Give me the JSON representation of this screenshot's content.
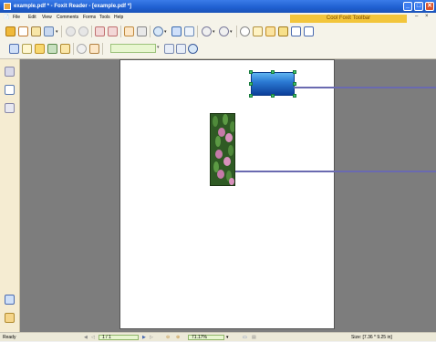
{
  "window": {
    "title": "example.pdf * - Foxit Reader - [example.pdf *]",
    "buttons": {
      "minimize": "_",
      "maximize": "□",
      "close": "✕"
    }
  },
  "menu": {
    "items": [
      "File",
      "Edit",
      "View",
      "Comments",
      "Forms",
      "Tools",
      "Help"
    ],
    "cool_toolbar": "Cool Foxit Toolbar",
    "mdi_buttons": [
      "–",
      "×"
    ]
  },
  "status": {
    "ready": "Ready",
    "page": "1 / 1",
    "zoom": "71.17%",
    "size": "Size: [7.36 * 9.25 in]"
  },
  "icons": [
    "open-folder-icon",
    "save-icon",
    "print-icon",
    "scan-icon",
    "back-icon",
    "forward-icon",
    "hand-tool-icon",
    "select-text-icon",
    "zoom-icon",
    "fit-page-icon",
    "zoom-out-icon",
    "zoom-in-icon",
    "note-icon",
    "typewriter-icon",
    "pencil-icon",
    "text-icon",
    "image-icon",
    "link-icon",
    "highlight-icon",
    "attachment-icon",
    "search-icon",
    "bookmarks-icon",
    "pages-icon",
    "layers-icon",
    "search-tab-icon",
    "attachments-tab-icon"
  ]
}
